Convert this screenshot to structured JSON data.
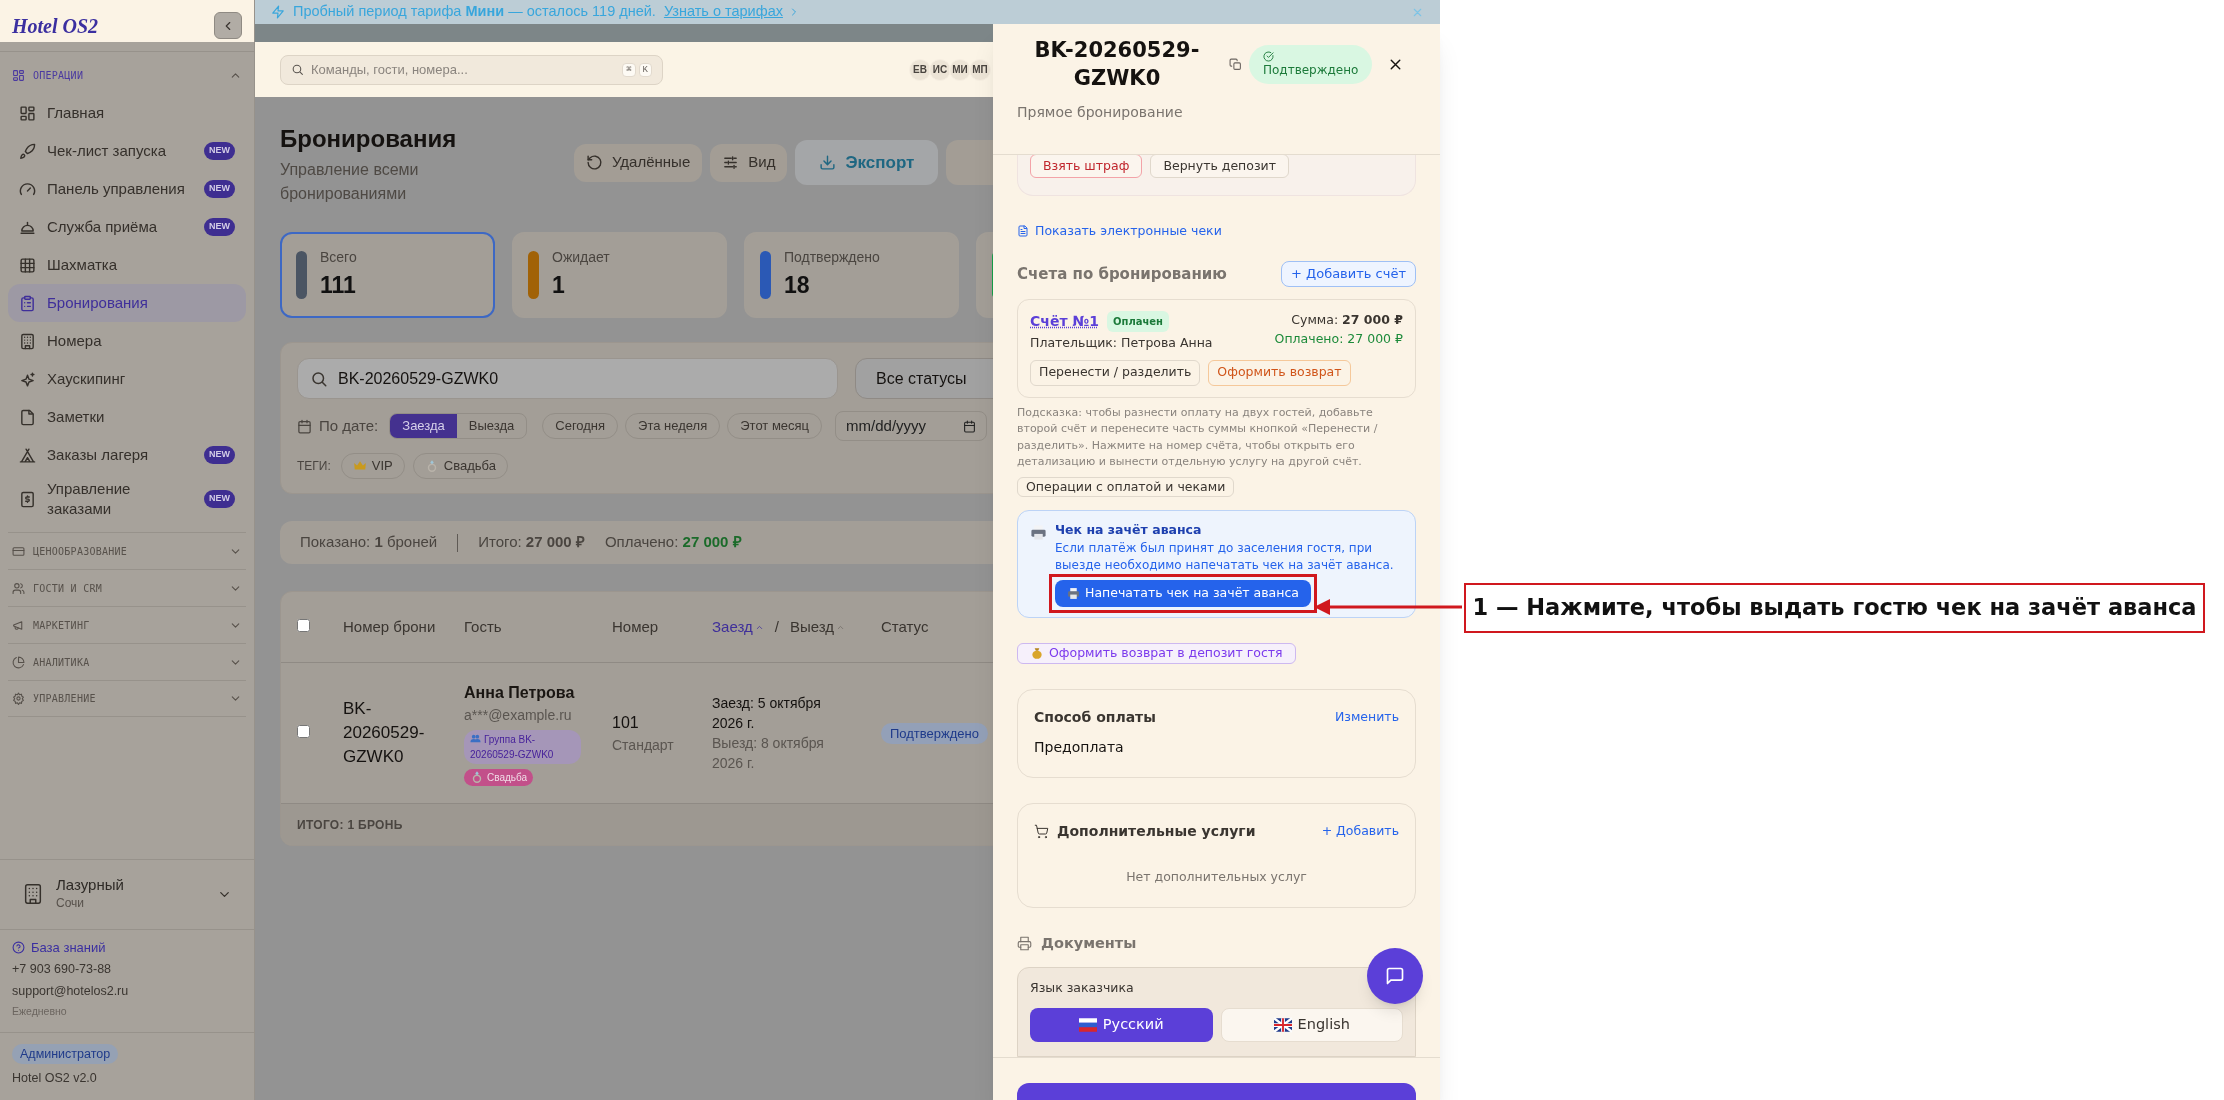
{
  "sidebar": {
    "logo": "Hotel OS2",
    "sections": [
      {
        "label": "ОПЕРАЦИИ",
        "expanded": true,
        "items": [
          {
            "label": "Главная",
            "selected": false
          },
          {
            "label": "Чек-лист запуска",
            "badge": "NEW",
            "selected": false
          },
          {
            "label": "Панель управления",
            "badge": "NEW",
            "selected": false
          },
          {
            "label": "Служба приёма",
            "badge": "NEW",
            "selected": false
          },
          {
            "label": "Шахматка",
            "selected": false
          },
          {
            "label": "Бронирования",
            "selected": true
          },
          {
            "label": "Номера",
            "selected": false
          },
          {
            "label": "Хаускипинг",
            "selected": false
          },
          {
            "label": "Заметки",
            "selected": false
          },
          {
            "label": "Заказы лагеря",
            "badge": "NEW",
            "selected": false
          },
          {
            "label": "Управление заказами",
            "badge": "NEW",
            "selected": false
          }
        ]
      },
      {
        "label": "ЦЕНООБРАЗОВАНИЕ",
        "expanded": false
      },
      {
        "label": "ГОСТИ И CRM",
        "expanded": false
      },
      {
        "label": "МАРКЕТИНГ",
        "expanded": false
      },
      {
        "label": "АНАЛИТИКА",
        "expanded": false
      },
      {
        "label": "УПРАВЛЕНИЕ",
        "expanded": false
      }
    ],
    "property": {
      "name": "Лазурный",
      "city": "Сочи"
    },
    "support": {
      "link": "База знаний",
      "phone": "+7 903 690-73-88",
      "email": "support@hotelos2.ru",
      "hours": "Ежедневно"
    },
    "role": "Администратор",
    "version": "Hotel OS2 v2.0"
  },
  "banner": {
    "text": "Пробный период тарифа **Мини** — осталось 119 дней.",
    "link": "Узнать о тарифах"
  },
  "header": {
    "search_placeholder": "Команды, гости, номера...",
    "shortcut": [
      "⌘",
      "K"
    ],
    "avatars": [
      "ЕВ",
      "ИС",
      "МИ",
      "МП"
    ]
  },
  "page": {
    "title": "Бронирования",
    "subtitle": "Управление всеми бронированиями",
    "actions": [
      "Удалённые",
      "Вид",
      "Экспорт"
    ]
  },
  "stats": [
    {
      "label": "Всего",
      "value": "111",
      "color": "#4b5563",
      "selected": true
    },
    {
      "label": "Ожидает",
      "value": "1",
      "color": "#a16207",
      "selected": false
    },
    {
      "label": "Подтверждено",
      "value": "18",
      "color": "#2b59b5",
      "selected": false
    },
    {
      "color": "#16a34a",
      "selected": false
    }
  ],
  "filters": {
    "search_value": "BK-20260529-GZWK0",
    "status": "Все статусы",
    "date_label": "По дате:",
    "date_modes": [
      {
        "label": "Заезда",
        "selected": true
      },
      {
        "label": "Выезда",
        "selected": false
      }
    ],
    "quick": [
      "Сегодня",
      "Эта неделя",
      "Этот месяц"
    ],
    "date_placeholder": "mm/dd/yyyy",
    "tags_label": "ТЕГИ:",
    "tags": [
      "VIP",
      "Свадьба"
    ]
  },
  "summary": {
    "shown": "Показано: **1** броней",
    "total": "Итого: **27 000 ₽**",
    "paid_label": "Оплачено:",
    "paid": "27 000 ₽"
  },
  "table": {
    "select_all_checked": false,
    "columns": [
      {
        "kind": "text",
        "label": "Номер брони"
      },
      {
        "kind": "text",
        "label": "Гость"
      },
      {
        "kind": "text",
        "label": "Номер"
      },
      {
        "kind": "sort_pair",
        "separator": "/",
        "parts": [
          {
            "label": "Заезд",
            "selected": true
          },
          {
            "label": "Выезд",
            "selected": false
          }
        ]
      },
      {
        "kind": "text",
        "label": "Статус"
      }
    ],
    "rows": [
      {
        "checked": false,
        "booking": "BK-20260529-GZWK0",
        "guest": "Анна Петрова",
        "email": "a***@example.ru",
        "group": "Группа BK-20260529-GZWK0",
        "tag": "Свадьба",
        "room": "101",
        "room_type": "Стандарт",
        "checkin": "Заезд: 5 октября 2026 г.",
        "checkout": "Выезд: 8 октября 2026 г.",
        "status": "Подтверждено"
      }
    ],
    "footer": "ИТОГО: 1 БРОНЬ"
  },
  "drawer": {
    "title": "BK-20260529-GZWK0",
    "status": "Подтверждено",
    "source": "Прямое бронирование",
    "deposit_actions": [
      "Взять штраф",
      "Вернуть депозит"
    ],
    "receipts_link": "Показать электронные чеки",
    "invoices": {
      "title": "Счета по бронированию",
      "add": "+ Добавить счёт",
      "items": [
        {
          "name": "Счёт №1",
          "status": "Оплачен",
          "payer": "Плательщик: Петрова Анна",
          "sum": "Сумма: **27 000 ₽**",
          "paid": "Оплачено: 27 000 ₽",
          "actions": [
            "Перенести / разделить",
            "Оформить возврат"
          ]
        }
      ],
      "hint": "Подсказка: чтобы разнести оплату на двух гостей, добавьте второй счёт и перенесите часть суммы кнопкой «Перенести / разделить». Нажмите на номер счёта, чтобы открыть его детализацию и вынести отдельную услугу на другой счёт.",
      "operations": "Операции с оплатой и чеками"
    },
    "advance": {
      "title": "Чек на зачёт аванса",
      "text": "Если платёж был принят до заселения гостя, при выезде необходимо напечатать чек на зачёт аванса.",
      "button": "Напечатать чек на зачёт аванса"
    },
    "refund_button": "Оформить возврат в депозит гостя",
    "payment": {
      "title": "Способ оплаты",
      "action": "Изменить",
      "value": "Предоплата"
    },
    "extras": {
      "title": "Дополнительные услуги",
      "action": "+ Добавить",
      "empty": "Нет дополнительных услуг"
    },
    "documents": {
      "title": "Документы",
      "language_label": "Язык заказчика",
      "languages": [
        {
          "label": "Русский",
          "selected": true
        },
        {
          "label": "English",
          "selected": false
        }
      ]
    }
  },
  "annotation": {
    "text": "1 — Нажмите, чтобы выдать гостю чек на зачёт аванса"
  }
}
